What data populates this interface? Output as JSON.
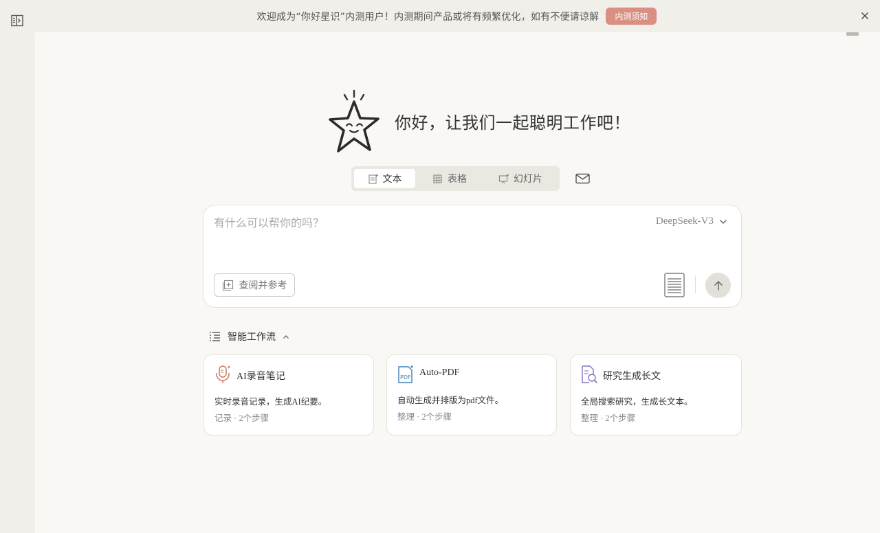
{
  "banner": {
    "text": "欢迎成为“你好星识”内测用户！内测期间产品或将有频繁优化，如有不便请谅解",
    "button_label": "内测须知"
  },
  "hero": {
    "title": "你好，让我们一起聪明工作吧！"
  },
  "mode_tabs": [
    {
      "label": "文本",
      "icon": "text-doc-icon",
      "active": true
    },
    {
      "label": "表格",
      "icon": "table-icon",
      "active": false
    },
    {
      "label": "幻灯片",
      "icon": "slides-icon",
      "active": false
    }
  ],
  "composer": {
    "placeholder": "有什么可以帮你的吗？",
    "model": "DeepSeek-V3",
    "ref_button_label": "查阅并参考"
  },
  "workflow": {
    "title": "智能工作流",
    "cards": [
      {
        "title": "AI录音笔记",
        "desc": "实时录音记录，生成AI纪要。",
        "meta": "记录 · 2个步骤",
        "icon": "microphone-icon"
      },
      {
        "title": "Auto-PDF",
        "desc": "自动生成并排版为pdf文件。",
        "meta": "整理 · 2个步骤",
        "icon": "pdf-icon"
      },
      {
        "title": "研究生成长文",
        "desc": "全局搜索研究，生成长文本。",
        "meta": "整理 · 2个步骤",
        "icon": "doc-search-icon"
      }
    ]
  },
  "colors": {
    "accent": "#d98f82",
    "background": "#f9f8f5",
    "sidebar": "#f1efea"
  }
}
